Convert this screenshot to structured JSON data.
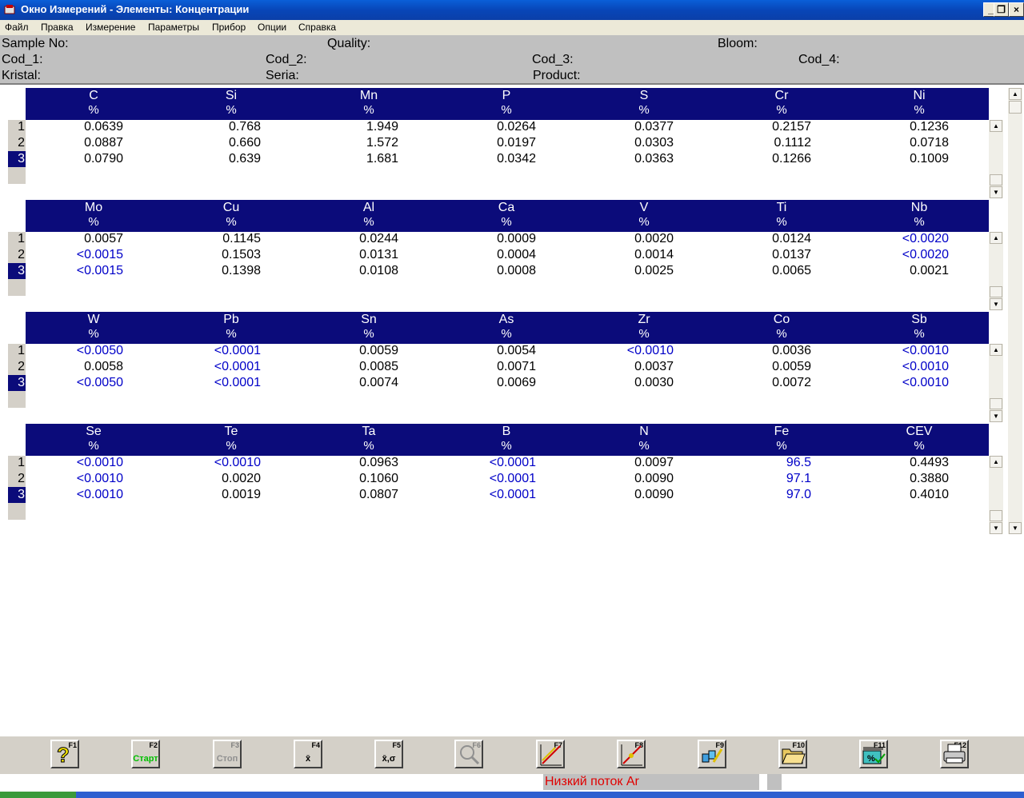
{
  "window": {
    "title": "Окно Измерений - Элементы: Концентрации",
    "controls": {
      "minimize": "_",
      "restore": "❐",
      "close": "×"
    }
  },
  "menu": [
    "Файл",
    "Правка",
    "Измерение",
    "Параметры",
    "Прибор",
    "Опции",
    "Справка"
  ],
  "info": {
    "sample_no": "Sample No:",
    "quality": "Quality:",
    "bloom": "Bloom:",
    "cod_1": "Cod_1:",
    "cod_2": "Cod_2:",
    "cod_3": "Cod_3:",
    "cod_4": "Cod_4:",
    "kristal": "Kristal:",
    "seria": "Seria:",
    "product": "Product:"
  },
  "row_numbers": [
    "1",
    "2",
    "3"
  ],
  "selected_row": 3,
  "blocks": [
    {
      "elements": [
        "C",
        "Si",
        "Mn",
        "P",
        "S",
        "Cr",
        "Ni"
      ],
      "units": [
        "%",
        "%",
        "%",
        "%",
        "%",
        "%",
        "%"
      ],
      "rows": [
        [
          "0.0639",
          "0.768",
          "1.949",
          "0.0264",
          "0.0377",
          "0.2157",
          "0.1236"
        ],
        [
          "0.0887",
          "0.660",
          "1.572",
          "0.0197",
          "0.0303",
          "0.1112",
          "0.0718"
        ],
        [
          "0.0790",
          "0.639",
          "1.681",
          "0.0342",
          "0.0363",
          "0.1266",
          "0.1009"
        ]
      ]
    },
    {
      "elements": [
        "Mo",
        "Cu",
        "Al",
        "Ca",
        "V",
        "Ti",
        "Nb"
      ],
      "units": [
        "%",
        "%",
        "%",
        "%",
        "%",
        "%",
        "%"
      ],
      "rows": [
        [
          "0.0057",
          "0.1145",
          "0.0244",
          "0.0009",
          "0.0020",
          "0.0124",
          "<0.0020"
        ],
        [
          "<0.0015",
          "0.1503",
          "0.0131",
          "0.0004",
          "0.0014",
          "0.0137",
          "<0.0020"
        ],
        [
          "<0.0015",
          "0.1398",
          "0.0108",
          "0.0008",
          "0.0025",
          "0.0065",
          "0.0021"
        ]
      ]
    },
    {
      "elements": [
        "W",
        "Pb",
        "Sn",
        "As",
        "Zr",
        "Co",
        "Sb"
      ],
      "units": [
        "%",
        "%",
        "%",
        "%",
        "%",
        "%",
        "%"
      ],
      "rows": [
        [
          "<0.0050",
          "<0.0001",
          "0.0059",
          "0.0054",
          "<0.0010",
          "0.0036",
          "<0.0010"
        ],
        [
          "0.0058",
          "<0.0001",
          "0.0085",
          "0.0071",
          "0.0037",
          "0.0059",
          "<0.0010"
        ],
        [
          "<0.0050",
          "<0.0001",
          "0.0074",
          "0.0069",
          "0.0030",
          "0.0072",
          "<0.0010"
        ]
      ]
    },
    {
      "elements": [
        "Se",
        "Te",
        "Ta",
        "B",
        "N",
        "Fe",
        "CEV"
      ],
      "units": [
        "%",
        "%",
        "%",
        "%",
        "%",
        "%",
        "%"
      ],
      "rows": [
        [
          "<0.0010",
          "<0.0010",
          "0.0963",
          "<0.0001",
          "0.0097",
          "96.5",
          "0.4493"
        ],
        [
          "<0.0010",
          "0.0020",
          "0.1060",
          "<0.0001",
          "0.0090",
          "97.1",
          "0.3880"
        ],
        [
          "<0.0010",
          "0.0019",
          "0.0807",
          "<0.0001",
          "0.0090",
          "97.0",
          "0.4010"
        ]
      ]
    }
  ],
  "blue_value_color": "#0000c8",
  "header_color": "#0b0b7a",
  "toolbar": [
    {
      "key": "F1",
      "icon": "help-icon",
      "label": "",
      "enabled": true
    },
    {
      "key": "F2",
      "icon": "start-icon",
      "label": "Старт",
      "enabled": true
    },
    {
      "key": "F3",
      "icon": "stop-icon",
      "label": "Стоп",
      "enabled": false
    },
    {
      "key": "F4",
      "icon": "mean-icon",
      "label": "x̄",
      "enabled": true
    },
    {
      "key": "F5",
      "icon": "mean-sigma-icon",
      "label": "x̄,σ",
      "enabled": true
    },
    {
      "key": "F6",
      "icon": "zoom-icon",
      "label": "",
      "enabled": false
    },
    {
      "key": "F7",
      "icon": "calibration-icon",
      "label": "",
      "enabled": true
    },
    {
      "key": "F8",
      "icon": "recalibration-icon",
      "label": "",
      "enabled": true
    },
    {
      "key": "F9",
      "icon": "samples-icon",
      "label": "",
      "enabled": true
    },
    {
      "key": "F10",
      "icon": "open-folder-icon",
      "label": "",
      "enabled": true
    },
    {
      "key": "F11",
      "icon": "percent-check-icon",
      "label": "",
      "enabled": true
    },
    {
      "key": "F12",
      "icon": "print-icon",
      "label": "",
      "enabled": true
    }
  ],
  "status": {
    "message": "Низкий поток Ar",
    "message_color": "#e00000"
  }
}
